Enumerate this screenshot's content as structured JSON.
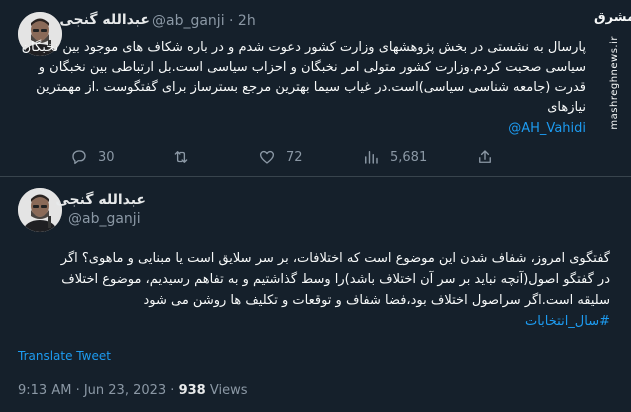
{
  "tweet1": {
    "display_name": "عبدالله گنجی",
    "handle_time": "@ab_ganji · 2h",
    "text_lines": [
      "پارسال به نشستی در بخش پژوهشهای وزارت کشور دعوت شدم و در باره شکاف های موجود بین نخبگان",
      "سیاسی صحبت کردم.وزارت کشور متولی امر نخبگان و احزاب سیاسی است.بل ارتباطی بین نخبگان و",
      "قدرت (جامعه شناسی سیاسی)است.در غیاب سیما بهترین مرجع بسترساز برای گفتگوست .از مهمترین",
      "نیازهای"
    ],
    "mention": "@AH_Vahidi",
    "actions": {
      "replies": "30",
      "retweets": "",
      "likes": "72",
      "views": "5,681"
    }
  },
  "tweet2": {
    "display_name": "عبدالله گنجی",
    "handle": "@ab_ganji",
    "text_lines": [
      "گفتگوی امروز، شفاف شدن این موضوع است که اختلافات، بر سر سلایق است یا مبنایی و ماهوی؟ اگر",
      "در گفتگو اصول(آنچه نباید بر سر آن اختلاف باشد)را وسط گذاشتیم و به تفاهم رسیدیم، موضوع اختلاف",
      "سلیقه است.اگر سراصول اختلاف بود،فضا شفاف و  توقعات و تکلیف ها روشن می شود"
    ],
    "hashtag": "#سال_انتخابات",
    "translate_label": "Translate Tweet",
    "timestamp": "9:13 AM · Jun 23, 2023 · ",
    "views_count": "938",
    "views_label": " Views"
  },
  "watermark": {
    "logo": "مشرق",
    "site": "mashreghnews.ir"
  },
  "colors": {
    "background": "#15202b",
    "text": "#f7f9f9",
    "muted": "#8b98a5",
    "link": "#1d9bf0",
    "divider": "#38444d"
  },
  "icons": [
    "reply-icon",
    "retweet-icon",
    "like-icon",
    "views-icon",
    "share-icon"
  ]
}
